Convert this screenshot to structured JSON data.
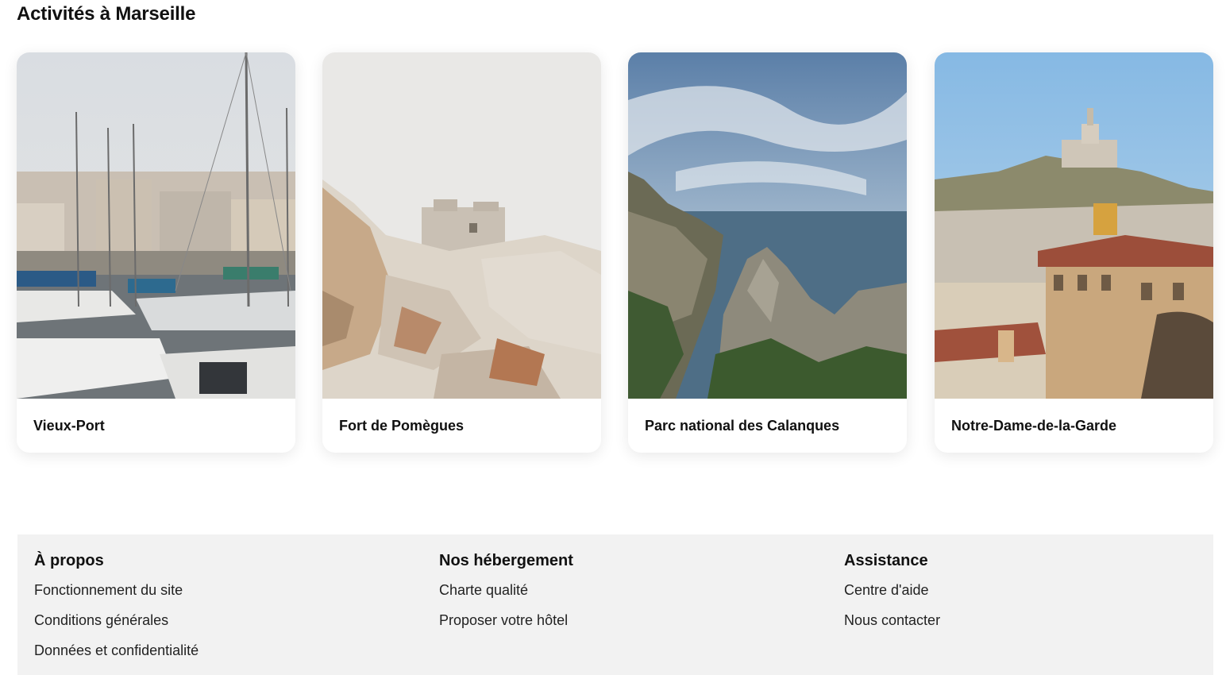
{
  "section": {
    "title": "Activités à Marseille"
  },
  "cards": [
    {
      "label": "Vieux-Port",
      "image": "harbor-sailboats-photo"
    },
    {
      "label": "Fort de Pomègues",
      "image": "rocky-fort-photo"
    },
    {
      "label": "Parc national des Calanques",
      "image": "calanques-cliffs-sea-photo"
    },
    {
      "label": "Notre-Dame-de-la-Garde",
      "image": "basilica-hill-city-photo"
    }
  ],
  "footer": {
    "columns": [
      {
        "heading": "À propos",
        "links": [
          "Fonctionnement du site",
          "Conditions générales",
          "Données et confidentialité"
        ]
      },
      {
        "heading": "Nos hébergement",
        "links": [
          "Charte qualité",
          "Proposer votre hôtel"
        ]
      },
      {
        "heading": "Assistance",
        "links": [
          "Centre d'aide",
          "Nous contacter"
        ]
      }
    ]
  }
}
